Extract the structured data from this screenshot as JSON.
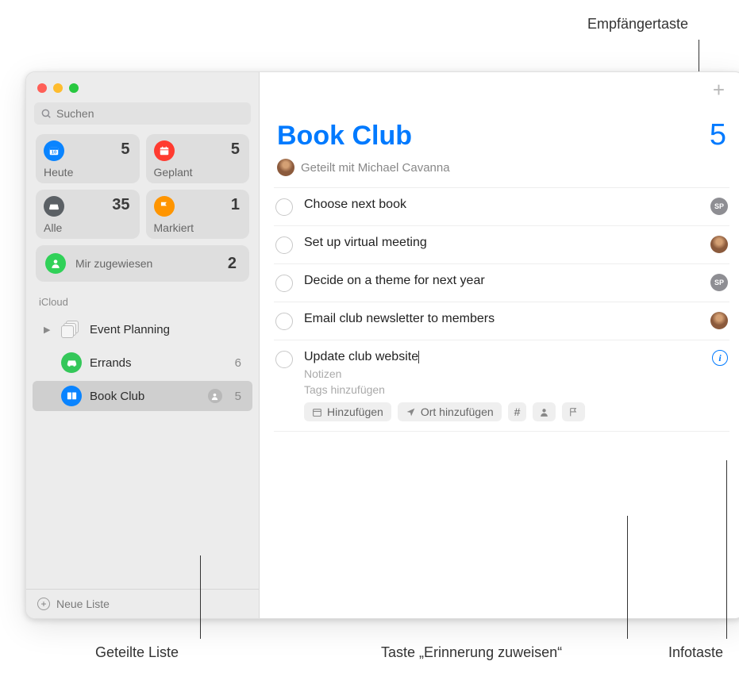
{
  "callouts": {
    "top": "Empfängertaste",
    "shared_list": "Geteilte Liste",
    "assign": "Taste „Erinnerung zuweisen“",
    "info": "Infotaste"
  },
  "search": {
    "placeholder": "Suchen"
  },
  "smart": {
    "today": {
      "label": "Heute",
      "count": "5",
      "color": "#0a84ff"
    },
    "scheduled": {
      "label": "Geplant",
      "count": "5",
      "color": "#ff3b30"
    },
    "all": {
      "label": "Alle",
      "count": "35",
      "color": "#5b6065"
    },
    "flagged": {
      "label": "Markiert",
      "count": "1",
      "color": "#ff9500"
    },
    "assigned": {
      "label": "Mir zugewiesen",
      "count": "2",
      "color": "#30d158"
    }
  },
  "account": {
    "name": "iCloud"
  },
  "lists": {
    "planning": {
      "name": "Event Planning"
    },
    "errands": {
      "name": "Errands",
      "count": "6",
      "color": "#34c759"
    },
    "bookclub": {
      "name": "Book Club",
      "count": "5",
      "color": "#0a84ff"
    }
  },
  "footer": {
    "new_list": "Neue Liste"
  },
  "main": {
    "title": "Book Club",
    "count": "5",
    "shared_prefix": "Geteilt mit",
    "shared_name": "Michael Cavanna"
  },
  "reminders": [
    {
      "title": "Choose next book",
      "assignee_type": "sp",
      "assignee_initials": "SP"
    },
    {
      "title": "Set up virtual meeting",
      "assignee_type": "av",
      "assignee_initials": ""
    },
    {
      "title": "Decide on a theme for next year",
      "assignee_type": "sp",
      "assignee_initials": "SP"
    },
    {
      "title": "Email club newsletter to members",
      "assignee_type": "av",
      "assignee_initials": ""
    }
  ],
  "editing": {
    "title": "Update club website",
    "notes": "Notizen",
    "tags": "Tags hinzufügen",
    "chip_date": "Hinzufügen",
    "chip_loc": "Ort hinzufügen",
    "chip_hash": "#"
  }
}
